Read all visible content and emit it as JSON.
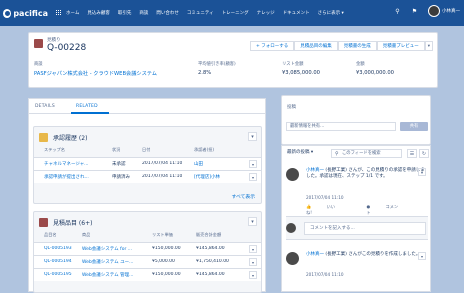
{
  "nav": {
    "logo": "pacifica",
    "items": [
      "ホーム",
      "見込み顧客",
      "取引先",
      "商談",
      "問い合わせ",
      "コミュニティ",
      "トレーニング",
      "ナレッジ",
      "ドキュメント",
      "さらに表示"
    ],
    "user": "小林真一"
  },
  "record": {
    "type": "見積り",
    "name": "Q-00228",
    "actions": [
      "+ フォローする",
      "見積品目の編集",
      "見積書の生成",
      "見積書プレビュー"
    ],
    "fields": [
      {
        "label": "商談",
        "value": "PASFジャパン株式会社 - クラウドWEB会議システム",
        "link": true
      },
      {
        "label": "平均値引き率(顧客)",
        "value": "2.8%",
        "link": false
      },
      {
        "label": "リスト金額",
        "value": "¥3,085,000.00",
        "link": false
      },
      {
        "label": "金額",
        "value": "¥3,000,000.00",
        "link": false
      }
    ]
  },
  "tabs": {
    "details": "DETAILS",
    "related": "RELATED"
  },
  "approvals": {
    "title": "承認履歴 (2)",
    "headers": [
      "ステップ名",
      "状況",
      "日付",
      "承認者(担)"
    ],
    "rows": [
      [
        "チャネルマネージャ...",
        "未承認",
        "2017/07/04 11:10",
        "山田"
      ],
      [
        "承認申請が提出され...",
        "申請済み",
        "2017/07/04 11:10",
        "[代理店]小林"
      ]
    ],
    "view_all": "すべて表示"
  },
  "quoteitems": {
    "title": "見積品目 (6+)",
    "headers": [
      "品目名",
      "商品",
      "リスト単価",
      "販売合計金額"
    ],
    "rows": [
      [
        "QL-0005193",
        "Web会議システム for ...",
        "¥150,000.00",
        "¥145,864.00"
      ],
      [
        "QL-0005194",
        "Web会議システム ユー...",
        "¥5,000.00",
        "¥1,750,410.00"
      ],
      [
        "QL-0005195",
        "Web会議システム 管理...",
        "¥150,000.00",
        "¥145,864.00"
      ]
    ]
  },
  "publisher": {
    "tab": "投稿",
    "placeholder": "最新情報を共有...",
    "button": "共有"
  },
  "feed": {
    "sort": "最新の投稿",
    "search_placeholder": "このフィードを検索",
    "posts": [
      {
        "author": "小林真一",
        "text": " (長野工業) さんが、この見積りの承認を申請しました。承認は現在、ステップ 1/1 です。",
        "date": "2017/07/04 11:10"
      },
      {
        "author": "小林真一",
        "text": " (長野工業) さんがこの見積りを作成しました。",
        "date": "2017/07/04 11:10"
      }
    ],
    "like": "いいね!",
    "comment": "コメント",
    "comment_placeholder": "コメントを記入する..."
  }
}
